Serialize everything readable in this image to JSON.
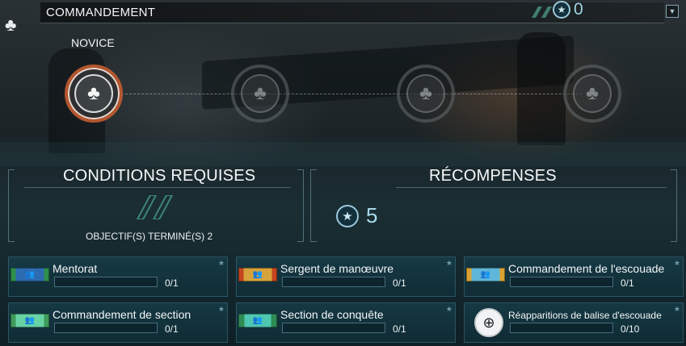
{
  "header": {
    "menu_icon": "club-icon",
    "title": "COMMANDEMENT",
    "currency_icon": "star-coin-icon",
    "currency_count": "0",
    "dropdown_icon": "chevron-down-icon"
  },
  "ranks": {
    "current_label": "NOVICE",
    "items": [
      {
        "state": "active",
        "icon": "club-icon"
      },
      {
        "state": "locked",
        "icon": "club-icon"
      },
      {
        "state": "locked",
        "icon": "club-icon"
      },
      {
        "state": "locked",
        "icon": "club-icon"
      }
    ]
  },
  "requirements": {
    "title": "CONDITIONS REQUISES",
    "objective_text": "OBJECTIF(S) TERMINÉ(S) 2"
  },
  "rewards": {
    "title": "RÉCOMPENSES",
    "icon": "star-coin-icon",
    "amount": "5"
  },
  "objectives": [
    {
      "name": "Mentorat",
      "progress": "0/1",
      "fraction": 0,
      "badge": "ribbon",
      "badge_color": "#2d6bb0"
    },
    {
      "name": "Sergent de manœuvre",
      "progress": "0/1",
      "fraction": 0,
      "badge": "ribbon",
      "badge_color": "#d6a23b"
    },
    {
      "name": "Commandement de l'escouade",
      "progress": "0/1",
      "fraction": 0,
      "badge": "ribbon",
      "badge_color": "#5fb6d8"
    },
    {
      "name": "Commandement de section",
      "progress": "0/1",
      "fraction": 0,
      "badge": "ribbon",
      "badge_color": "#68d2a4"
    },
    {
      "name": "Section de conquête",
      "progress": "0/1",
      "fraction": 0,
      "badge": "ribbon",
      "badge_color": "#4ec7b0"
    },
    {
      "name": "Réapparitions de balise d'escouade",
      "progress": "0/10",
      "fraction": 0,
      "badge": "crosshair-icon",
      "badge_color": "#f1f3f4"
    }
  ],
  "icons": {
    "star": "★",
    "club": "♣",
    "chevron": "▼",
    "crosshair": "⊕",
    "people": "👥"
  },
  "colors": {
    "accent": "#9fd3e4",
    "active_rank": "#b4562f",
    "card_bg": "#163e4a",
    "bar_fill": "#8fd0e4"
  }
}
